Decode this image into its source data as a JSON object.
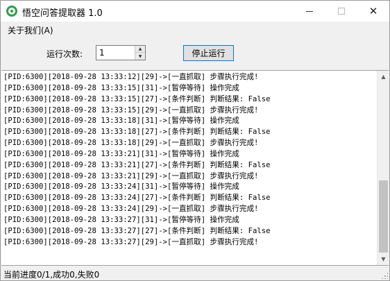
{
  "window": {
    "title": "悟空问答提取器 1.0",
    "close_glyph": "✕"
  },
  "menu": {
    "about_label": "关于我们(A)"
  },
  "controls": {
    "run_count_label": "运行次数:",
    "run_count_value": "1",
    "stop_button_label": "停止运行"
  },
  "log": {
    "lines": [
      "[PID:6300][2018-09-28 13:33:12][29]->[一直抓取] 步骤执行完成!",
      "[PID:6300][2018-09-28 13:33:15][31]->[暂停等待] 操作完成",
      "[PID:6300][2018-09-28 13:33:15][27]->[条件判断] 判断结果: False",
      "[PID:6300][2018-09-28 13:33:15][29]->[一直抓取] 步骤执行完成!",
      "[PID:6300][2018-09-28 13:33:18][31]->[暂停等待] 操作完成",
      "[PID:6300][2018-09-28 13:33:18][27]->[条件判断] 判断结果: False",
      "[PID:6300][2018-09-28 13:33:18][29]->[一直抓取] 步骤执行完成!",
      "[PID:6300][2018-09-28 13:33:21][31]->[暂停等待] 操作完成",
      "[PID:6300][2018-09-28 13:33:21][27]->[条件判断] 判断结果: False",
      "[PID:6300][2018-09-28 13:33:21][29]->[一直抓取] 步骤执行完成!",
      "[PID:6300][2018-09-28 13:33:24][31]->[暂停等待] 操作完成",
      "[PID:6300][2018-09-28 13:33:24][27]->[条件判断] 判断结果: False",
      "[PID:6300][2018-09-28 13:33:24][29]->[一直抓取] 步骤执行完成!",
      "[PID:6300][2018-09-28 13:33:27][31]->[暂停等待] 操作完成",
      "[PID:6300][2018-09-28 13:33:27][27]->[条件判断] 判断结果: False",
      "[PID:6300][2018-09-28 13:33:27][29]->[一直抓取] 步骤执行完成!"
    ]
  },
  "status": {
    "text": "当前进度0/1,成功0,失败0"
  },
  "colors": {
    "accent": "#0078d7",
    "icon_green": "#2e9d4b"
  }
}
